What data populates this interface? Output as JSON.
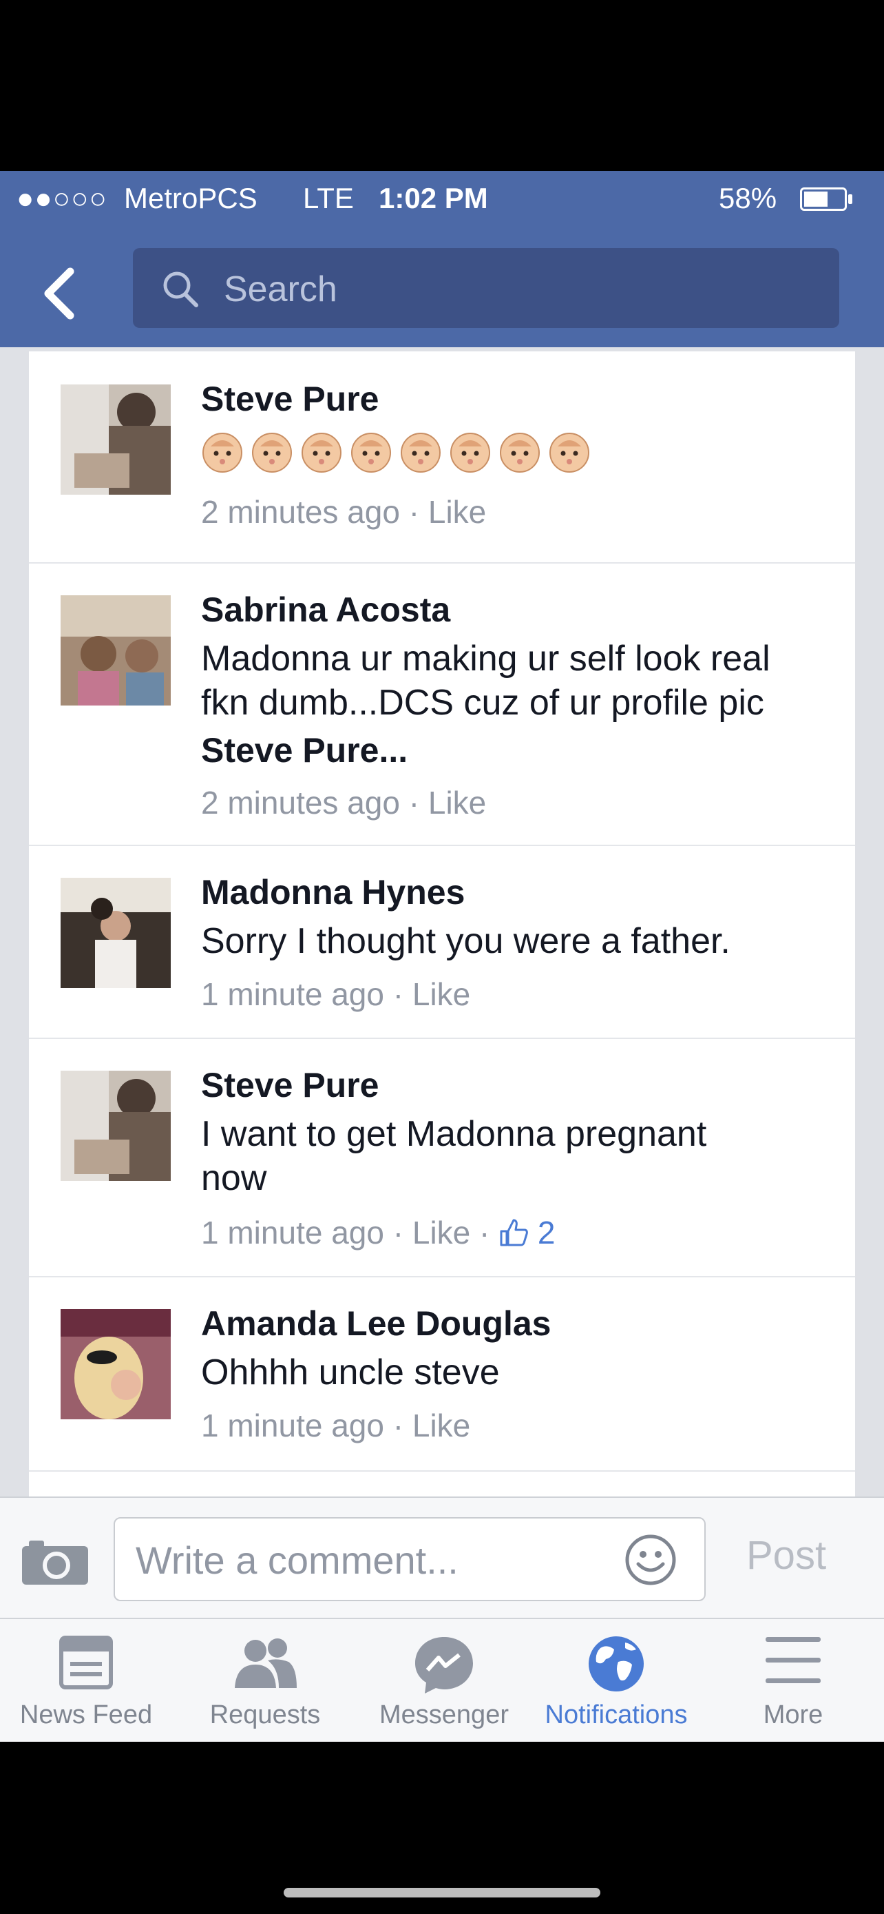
{
  "status_bar": {
    "signal": "●●○○○",
    "carrier": "MetroPCS",
    "network": "LTE",
    "time": "1:02 PM",
    "battery": "58%",
    "battery_level": 0.58
  },
  "search": {
    "placeholder": "Search"
  },
  "comments": [
    {
      "name": "Steve Pure",
      "text": "",
      "emoji_count": 8,
      "time": "2 minutes ago",
      "like": "Like"
    },
    {
      "name": "Sabrina Acosta",
      "text_lines": [
        "Madonna ur making ur self look real",
        "fkn dumb...DCS cuz of ur profile pic"
      ],
      "mention": "Steve Pure...",
      "time": "2 minutes ago",
      "like": "Like"
    },
    {
      "name": "Madonna Hynes",
      "text_lines": [
        "Sorry I thought you were a father."
      ],
      "time": "1 minute ago",
      "like": "Like"
    },
    {
      "name": "Steve Pure",
      "text_lines": [
        "I want to get Madonna pregnant",
        "now"
      ],
      "time": "1 minute ago",
      "like": "Like",
      "like_count": "2"
    },
    {
      "name": "Amanda Lee Douglas",
      "text_lines": [
        "Ohhhh uncle steve"
      ],
      "time": "1 minute ago",
      "like": "Like"
    }
  ],
  "composer": {
    "placeholder": "Write a comment...",
    "post_label": "Post"
  },
  "tabs": [
    {
      "label": "News Feed",
      "icon": "news-feed-icon"
    },
    {
      "label": "Requests",
      "icon": "friend-requests-icon"
    },
    {
      "label": "Messenger",
      "icon": "messenger-icon"
    },
    {
      "label": "Notifications",
      "icon": "globe-icon",
      "active": true
    },
    {
      "label": "More",
      "icon": "menu-icon"
    }
  ],
  "colors": {
    "brand": "#4c69a7",
    "active_tab": "#4a7bd4",
    "meta": "#9197a3"
  }
}
